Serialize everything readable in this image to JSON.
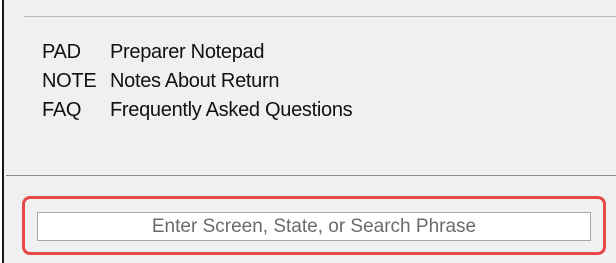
{
  "shortcuts": [
    {
      "code": "PAD",
      "description": "Preparer Notepad"
    },
    {
      "code": "NOTE",
      "description": "Notes About Return"
    },
    {
      "code": "FAQ",
      "description": "Frequently Asked Questions"
    }
  ],
  "search": {
    "placeholder": "Enter Screen, State, or Search Phrase",
    "value": ""
  },
  "colors": {
    "highlight": "#e8474a",
    "panel_background": "#f0f0f0"
  }
}
